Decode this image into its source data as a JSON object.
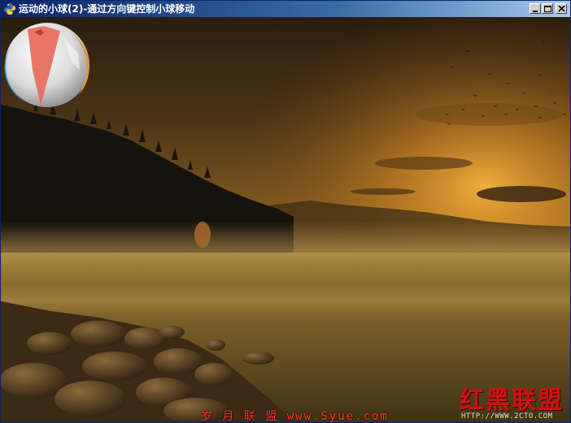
{
  "window": {
    "title": "运动的小球(2)-通过方向键控制小球移动",
    "icon": "python-icon",
    "controls": {
      "minimize": "minimize-icon",
      "maximize": "maximize-icon",
      "close": "close-icon"
    }
  },
  "scene": {
    "description_icon": "misty-lake-sunset-background",
    "ball_icon": "ball-sprite-icon"
  },
  "watermarks": {
    "credit": "岁 月 联 盟  www.Syue.com",
    "logo": "红黑联盟",
    "logo_url": "HTTP://WWW.2CTO.COM"
  },
  "colors": {
    "titlebar_start": "#0a246a",
    "titlebar_end": "#a6caf0",
    "credit_text": "#ff3030",
    "logo_text": "#d01010"
  }
}
